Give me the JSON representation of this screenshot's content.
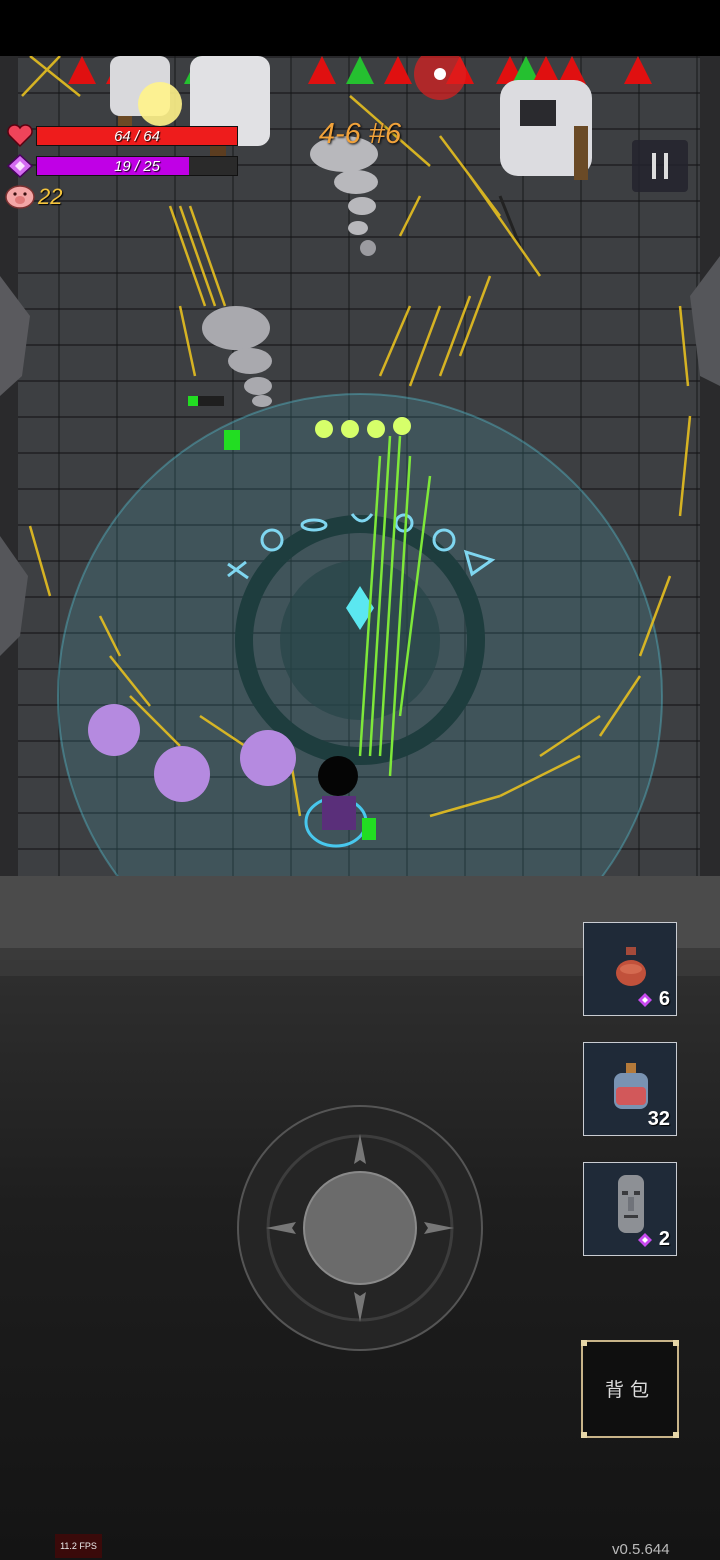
{
  "hud": {
    "hp_text": "64 / 64",
    "hp_value": 64,
    "hp_max": 64,
    "mana_text": "19 / 25",
    "mana_value": 19,
    "mana_max": 25,
    "coins": "22",
    "stage": "4-6 #6"
  },
  "inventory": [
    {
      "name": "clay-pot",
      "count": "6",
      "gem_cost": true
    },
    {
      "name": "red-potion",
      "count": "32",
      "gem_cost": false
    },
    {
      "name": "stone-moai-statue",
      "count": "2",
      "gem_cost": true
    }
  ],
  "backpack_label": "背包",
  "fps": "11.2 FPS",
  "version": "v0.5.644",
  "colors": {
    "hp": "#ee1c1c",
    "mana": "#c000e6",
    "coin": "#f4c43c",
    "stage": "#f1a23a",
    "spell_circle": "#3bb9c8",
    "arrows": "#e7c020",
    "enemy_blob": "#b58ae0"
  },
  "icons": {
    "hp": "heart-icon",
    "mana": "gem-icon",
    "coin": "pig-coin-icon",
    "pause": "pause-icon"
  }
}
